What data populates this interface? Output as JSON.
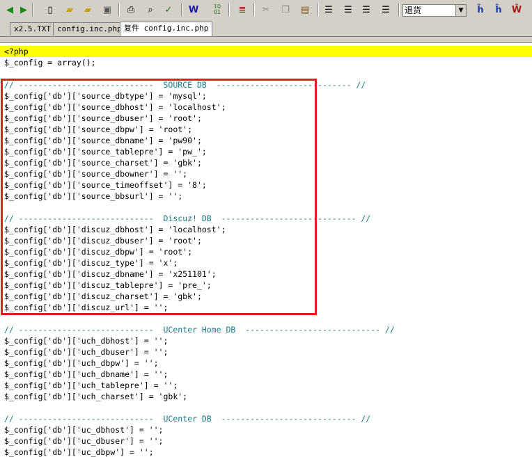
{
  "toolbar": {
    "buttons": [
      "back-icon",
      "forward-icon",
      "new-file-icon",
      "open-file-icon",
      "open-folder-icon",
      "save-icon",
      "print-icon",
      "print-preview-icon",
      "spell-check-icon",
      "word-wrap-icon",
      "hex-icon",
      "ruler-icon",
      "cut-icon",
      "copy-icon",
      "paste-icon",
      "align-left-icon",
      "align-center-icon",
      "align-right-icon",
      "justify-icon",
      "find-icon",
      "find-in-files-icon",
      "replace-icon",
      "mark-icon"
    ],
    "dropdown_value": "退货"
  },
  "tabs": [
    "x2.5.TXT",
    "config.inc.php",
    "复件 config.inc.php"
  ],
  "active_tab": 2,
  "code_lines": [
    "<?php",
    "$_config = array();",
    "",
    "// ----------------------------  SOURCE DB  ---------------------------- //",
    "$_config['db']['source_dbtype'] = 'mysql';",
    "$_config['db']['source_dbhost'] = 'localhost';",
    "$_config['db']['source_dbuser'] = 'root';",
    "$_config['db']['source_dbpw'] = 'root';",
    "$_config['db']['source_dbname'] = 'pw90';",
    "$_config['db']['source_tablepre'] = 'pw_';",
    "$_config['db']['source_charset'] = 'gbk';",
    "$_config['db']['source_dbowner'] = '';",
    "$_config['db']['source_timeoffset'] = '8';",
    "$_config['db']['source_bbsurl'] = '';",
    "",
    "// ----------------------------  Discuz! DB  ---------------------------- //",
    "$_config['db']['discuz_dbhost'] = 'localhost';",
    "$_config['db']['discuz_dbuser'] = 'root';",
    "$_config['db']['discuz_dbpw'] = 'root';",
    "$_config['db']['discuz_type'] = 'x';",
    "$_config['db']['discuz_dbname'] = 'x251101';",
    "$_config['db']['discuz_tablepre'] = 'pre_';",
    "$_config['db']['discuz_charset'] = 'gbk';",
    "$_config['db']['discuz_url'] = '';",
    "",
    "// ----------------------------  UCenter Home DB  ---------------------------- //",
    "$_config['db']['uch_dbhost'] = '';",
    "$_config['db']['uch_dbuser'] = '';",
    "$_config['db']['uch_dbpw'] = '';",
    "$_config['db']['uch_dbname'] = '';",
    "$_config['db']['uch_tablepre'] = '';",
    "$_config['db']['uch_charset'] = 'gbk';",
    "",
    "// ----------------------------  UCenter DB  ---------------------------- //",
    "$_config['db']['uc_dbhost'] = '';",
    "$_config['db']['uc_dbuser'] = '';",
    "$_config['db']['uc_dbpw'] = '';"
  ],
  "colors": {
    "current_line": "#ffff00",
    "comment": "#1a7a8a",
    "highlight_box": "#e02020"
  }
}
